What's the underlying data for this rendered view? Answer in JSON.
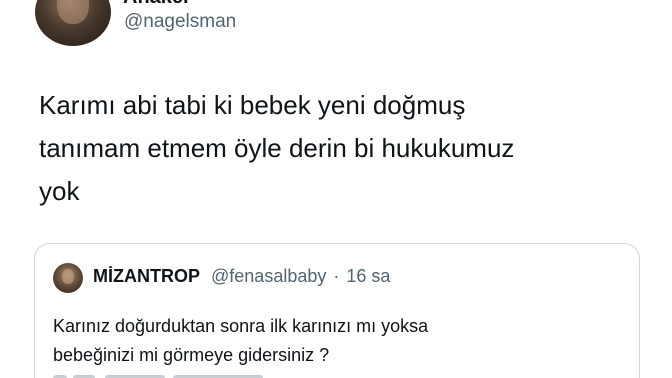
{
  "author": {
    "display_name": "Anakei",
    "handle": "@nagelsman"
  },
  "tweet": {
    "lines": [
      "Karımı abi tabi ki bebek yeni doğmuş",
      "tanımam etmem öyle derin bi hukukumuz",
      "yok"
    ]
  },
  "quoted_tweet": {
    "display_name": "MİZANTROP",
    "handle": "@fenasalbaby",
    "separator": "·",
    "time": "16 sa",
    "lines": [
      "Karınız doğurduktan sonra ilk karınızı mı yoksa",
      "bebeğinizi mi görmeye gidersiniz ?"
    ]
  },
  "colors": {
    "text_primary": "#0f1419",
    "text_secondary": "#536471",
    "card_border": "#cfd9de",
    "background": "#ffffff"
  }
}
